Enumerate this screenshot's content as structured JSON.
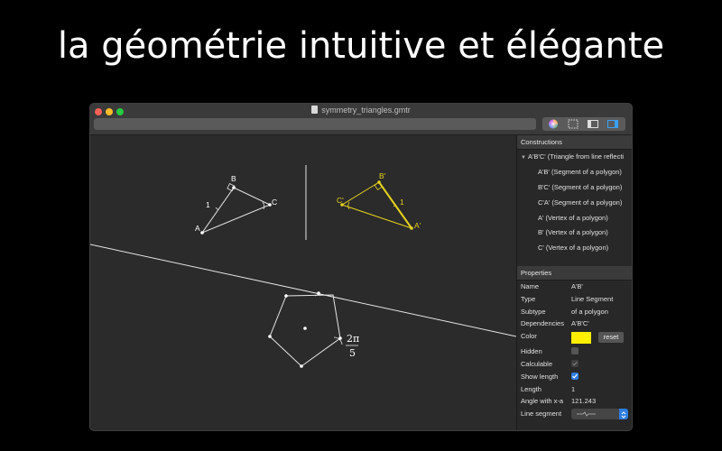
{
  "headline": "la géométrie intuitive et élégante",
  "window": {
    "title": "symmetry_triangles.gmtr"
  },
  "toolbar": {
    "icons": [
      "color-wheel-icon",
      "selection-box-icon",
      "sidebar-left-icon",
      "sidebar-right-icon"
    ]
  },
  "canvas": {
    "labels": {
      "A": "A",
      "B": "B",
      "C": "C",
      "A_prime": "A'",
      "B_prime": "B'",
      "C_prime": "C'",
      "len1": "1",
      "len1_prime": "1",
      "angle_num": "2π",
      "angle_den": "5"
    },
    "colors": {
      "shape": "#e6e6e6",
      "selected": "#e5d21e"
    }
  },
  "constructions": {
    "header": "Constructions",
    "parent": "A'B'C' (Triangle from line reflecti",
    "items": [
      "A'B' (Segment of a polygon)",
      "B'C' (Segment of a polygon)",
      "C'A' (Segment of a polygon)",
      "A' (Vertex of a polygon)",
      "B' (Vertex of a polygon)",
      "C' (Vertex of a polygon)"
    ]
  },
  "properties": {
    "header": "Properties",
    "rows": {
      "name": {
        "label": "Name",
        "value": "A'B'"
      },
      "type": {
        "label": "Type",
        "value": "Line Segment"
      },
      "subtype": {
        "label": "Subtype",
        "value": "of a polygon"
      },
      "dependencies": {
        "label": "Dependencies",
        "value": "A'B'C'"
      },
      "color": {
        "label": "Color",
        "value": "#ffee00",
        "button": "reset"
      },
      "hidden": {
        "label": "Hidden",
        "checked": false
      },
      "calculable": {
        "label": "Calculable",
        "checked": true,
        "disabled": true
      },
      "show_length": {
        "label": "Show length",
        "checked": true
      },
      "length": {
        "label": "Length",
        "value": "1"
      },
      "angle": {
        "label": "Angle with x-a",
        "value": "121.243"
      },
      "line_segment": {
        "label": "Line segment"
      }
    }
  }
}
